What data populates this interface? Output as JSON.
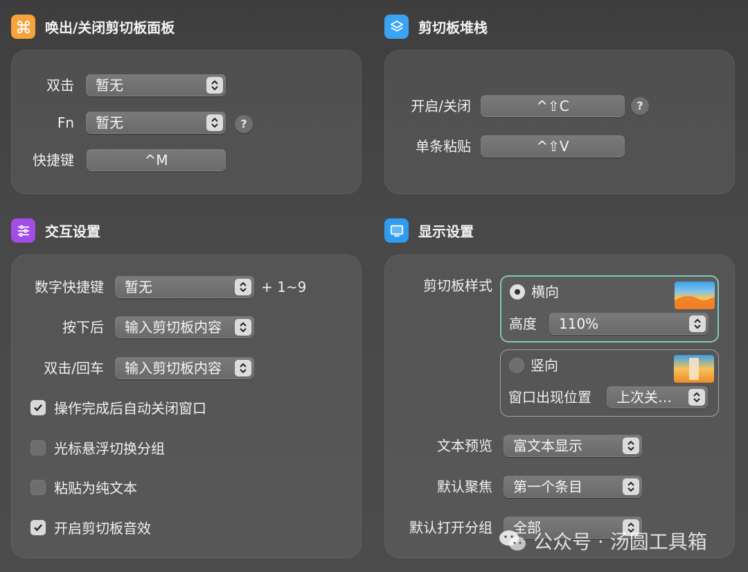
{
  "sections": {
    "invoke": {
      "title": "唤出/关闭剪切板面板",
      "icon": "command-icon",
      "color": "#f7a23a"
    },
    "stack": {
      "title": "剪切板堆栈",
      "icon": "layers-icon",
      "color": "#3aa3f2"
    },
    "interact": {
      "title": "交互设置",
      "icon": "sliders-icon",
      "color": "#a34de8"
    },
    "display": {
      "title": "显示设置",
      "icon": "monitor-icon",
      "color": "#2f9cf0"
    }
  },
  "invoke": {
    "double_click_label": "双击",
    "double_click_value": "暂无",
    "fn_label": "Fn",
    "fn_value": "暂无",
    "help_glyph": "?",
    "shortcut_label": "快捷键",
    "shortcut_value": "^M"
  },
  "stack": {
    "toggle_label": "开启/关闭",
    "toggle_value": "^⇧C",
    "help_glyph": "?",
    "single_paste_label": "单条粘贴",
    "single_paste_value": "^⇧V"
  },
  "interact": {
    "number_shortcut_label": "数字快捷键",
    "number_shortcut_value": "暂无",
    "number_suffix": "+ 1~9",
    "after_press_label": "按下后",
    "after_press_value": "输入剪切板内容",
    "double_enter_label": "双击/回车",
    "double_enter_value": "输入剪切板内容",
    "checkboxes": [
      {
        "label": "操作完成后自动关闭窗口",
        "checked": true
      },
      {
        "label": "光标悬浮切换分组",
        "checked": false
      },
      {
        "label": "粘贴为纯文本",
        "checked": false
      },
      {
        "label": "开启剪切板音效",
        "checked": true
      }
    ]
  },
  "display": {
    "style_label": "剪切板样式",
    "horizontal": {
      "label": "横向",
      "selected": true,
      "height_label": "高度",
      "height_value": "110%"
    },
    "vertical": {
      "label": "竖向",
      "selected": false,
      "position_label": "窗口出现位置",
      "position_value": "上次关…"
    },
    "text_preview_label": "文本预览",
    "text_preview_value": "富文本显示",
    "default_focus_label": "默认聚焦",
    "default_focus_value": "第一个条目",
    "default_group_label": "默认打开分组",
    "default_group_value": "全部"
  },
  "watermark": {
    "text": "公众号 · 汤圆工具箱",
    "icon": "wechat-icon"
  }
}
